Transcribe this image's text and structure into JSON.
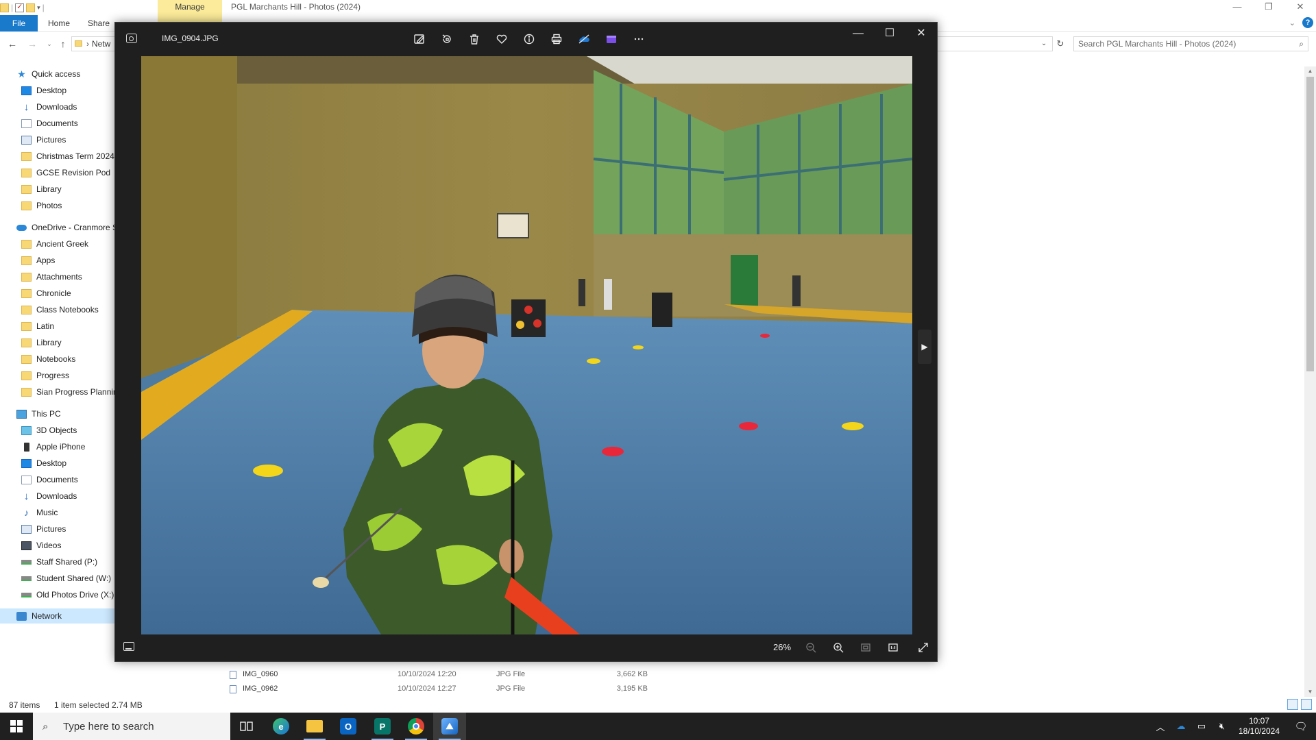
{
  "explorer": {
    "window_title": "PGL Marchants Hill - Photos (2024)",
    "manage_tab": "Manage",
    "tabs": [
      "File",
      "Home",
      "Share"
    ],
    "address_text": "Netw",
    "search_placeholder": "Search PGL Marchants Hill - Photos (2024)",
    "quick_access": [
      {
        "label": "Quick access",
        "icon": "star-icon"
      },
      {
        "label": "Desktop",
        "icon": "desktop-icon"
      },
      {
        "label": "Downloads",
        "icon": "downloads-icon"
      },
      {
        "label": "Documents",
        "icon": "documents-icon"
      },
      {
        "label": "Pictures",
        "icon": "pictures-icon"
      },
      {
        "label": "Christmas Term 2024",
        "icon": "folder-icon"
      },
      {
        "label": "GCSE Revision Pod",
        "icon": "folder-icon"
      },
      {
        "label": "Library",
        "icon": "folder-icon"
      },
      {
        "label": "Photos",
        "icon": "folder-icon"
      }
    ],
    "onedrive": [
      {
        "label": "OneDrive - Cranmore S",
        "icon": "onedrive-icon"
      },
      {
        "label": "Ancient Greek",
        "icon": "folder-icon"
      },
      {
        "label": "Apps",
        "icon": "folder-icon"
      },
      {
        "label": "Attachments",
        "icon": "folder-icon"
      },
      {
        "label": "Chronicle",
        "icon": "folder-icon"
      },
      {
        "label": "Class Notebooks",
        "icon": "folder-icon"
      },
      {
        "label": "Latin",
        "icon": "folder-icon"
      },
      {
        "label": "Library",
        "icon": "folder-icon"
      },
      {
        "label": "Notebooks",
        "icon": "folder-icon"
      },
      {
        "label": "Progress",
        "icon": "folder-icon"
      },
      {
        "label": "Sian Progress Plannin",
        "icon": "folder-icon"
      }
    ],
    "this_pc": [
      {
        "label": "This PC",
        "icon": "pc-icon"
      },
      {
        "label": "3D Objects",
        "icon": "3d-objects-icon"
      },
      {
        "label": "Apple iPhone",
        "icon": "phone-icon"
      },
      {
        "label": "Desktop",
        "icon": "desktop-icon"
      },
      {
        "label": "Documents",
        "icon": "documents-icon"
      },
      {
        "label": "Downloads",
        "icon": "downloads-icon"
      },
      {
        "label": "Music",
        "icon": "music-icon"
      },
      {
        "label": "Pictures",
        "icon": "pictures-icon"
      },
      {
        "label": "Videos",
        "icon": "videos-icon"
      },
      {
        "label": "Staff Shared (P:)",
        "icon": "network-drive-icon"
      },
      {
        "label": "Student Shared (W:)",
        "icon": "network-drive-icon"
      },
      {
        "label": "Old Photos Drive (X:)",
        "icon": "network-drive-icon"
      }
    ],
    "network": {
      "label": "Network",
      "icon": "network-icon"
    },
    "files": [
      {
        "name": "IMG_0960",
        "date": "10/10/2024 12:20",
        "type": "JPG File",
        "size": "3,662 KB"
      },
      {
        "name": "IMG_0962",
        "date": "10/10/2024 12:27",
        "type": "JPG File",
        "size": "3,195 KB"
      }
    ],
    "status_items": "87 items",
    "status_selected": "1 item selected  2.74 MB"
  },
  "photos": {
    "filename": "IMG_0904.JPG",
    "toolbar": [
      {
        "name": "edit-image-icon"
      },
      {
        "name": "rotate-icon"
      },
      {
        "name": "delete-icon"
      },
      {
        "name": "favorite-heart-icon"
      },
      {
        "name": "info-icon"
      },
      {
        "name": "print-icon"
      },
      {
        "name": "onedrive-icon"
      },
      {
        "name": "video-editor-icon"
      },
      {
        "name": "more-options-icon"
      }
    ],
    "zoom": "26%"
  },
  "taskbar": {
    "search_placeholder": "Type here to search",
    "time": "10:07",
    "date": "18/10/2024",
    "apps": [
      "task-view-icon",
      "edge-icon",
      "file-explorer-icon",
      "outlook-icon",
      "publisher-icon",
      "chrome-icon",
      "photos-icon"
    ]
  }
}
